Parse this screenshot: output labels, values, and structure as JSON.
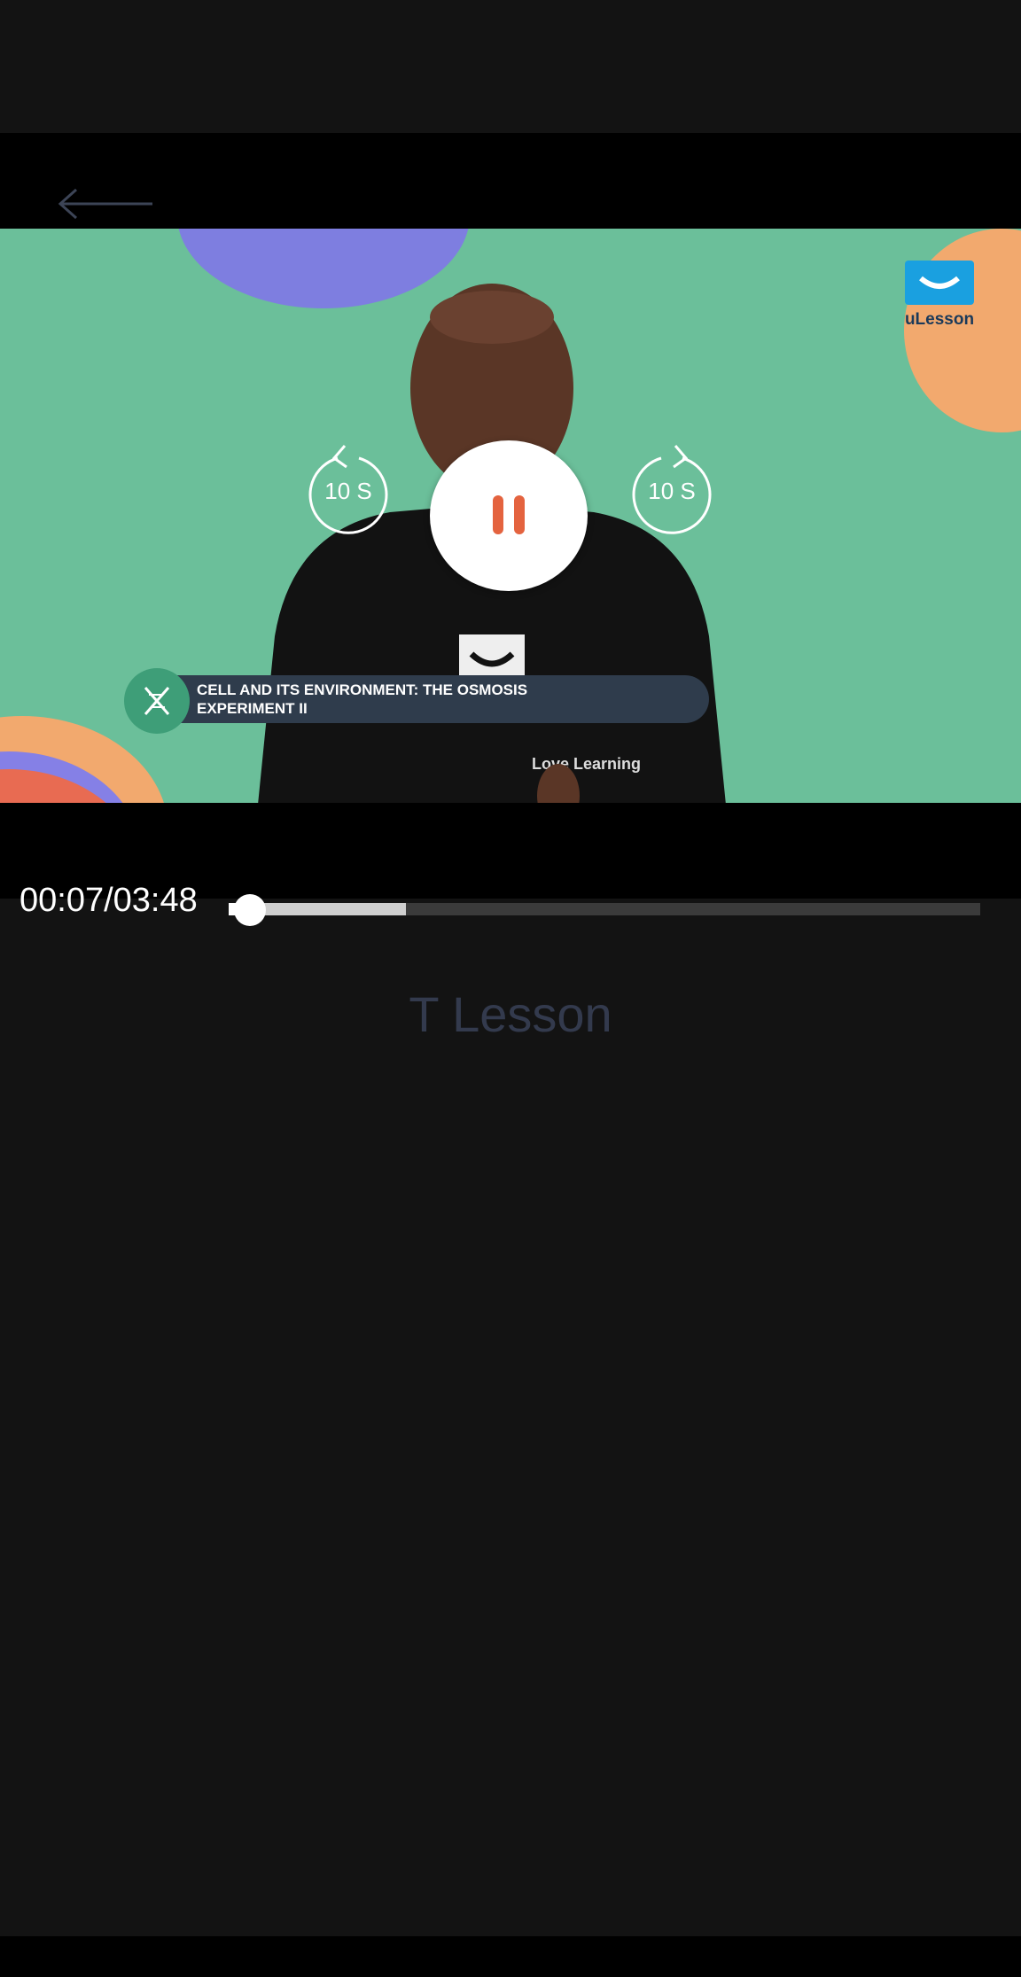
{
  "player": {
    "back_icon": "arrow-left-icon",
    "brand_logo_text": "uLesson",
    "lower_third_text": "CELL AND ITS ENVIRONMENT: THE OSMOSIS EXPERIMENT II",
    "lower_third_icon": "dna-icon",
    "rewind_label": "10 S",
    "forward_label": "10 S",
    "state": "playing",
    "pause_icon": "pause-icon",
    "time_display": "00:07/03:48",
    "progress_played_fraction": 0.031,
    "progress_buffered_fraction": 0.236
  },
  "lesson": {
    "title": "T Lesson"
  },
  "colors": {
    "background": "#131313",
    "video_bg": "#6bbf9a",
    "accent": "#e4633f",
    "title_text": "#333a4d"
  }
}
